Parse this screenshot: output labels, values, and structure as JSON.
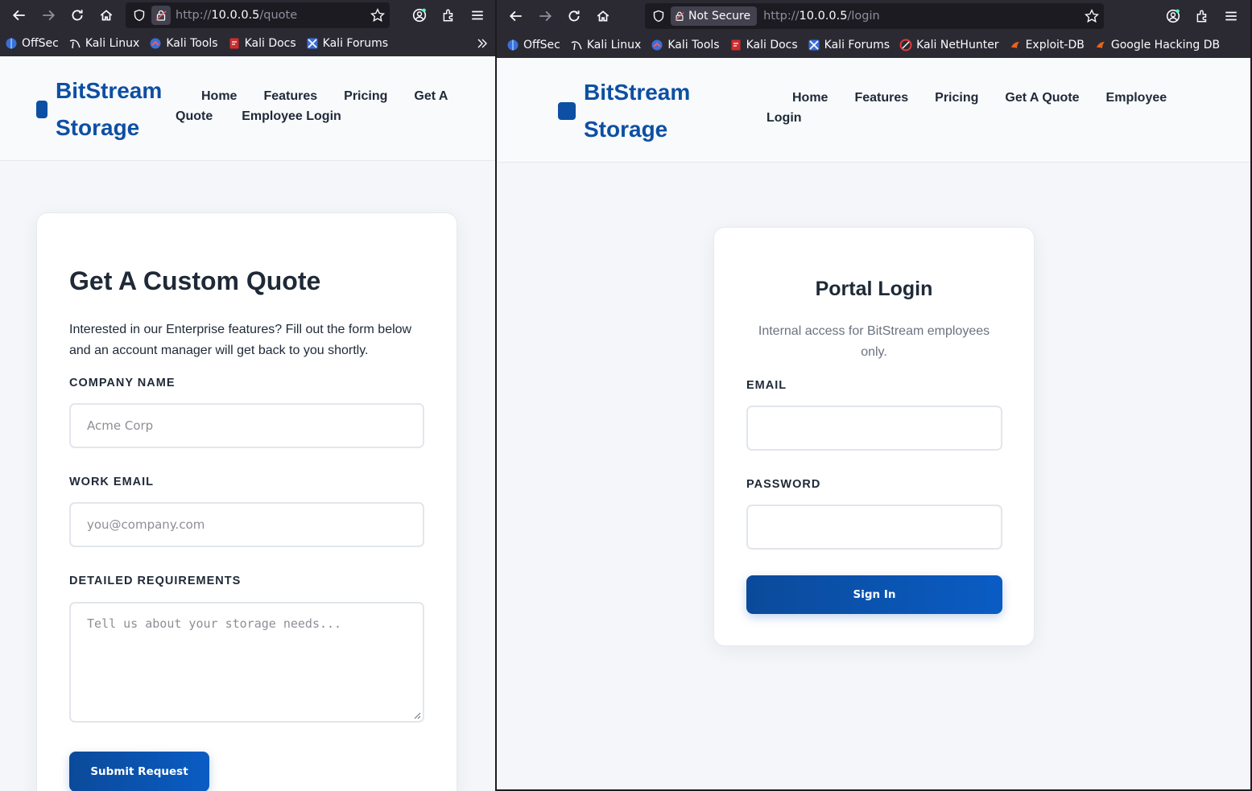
{
  "left_window": {
    "url_scheme": "http://",
    "url_host": "10.0.0.5",
    "url_path": "/quote",
    "bookmarks": [
      {
        "label": "OffSec",
        "icon": "offsec-icon"
      },
      {
        "label": "Kali Linux",
        "icon": "kali-dragon-icon"
      },
      {
        "label": "Kali Tools",
        "icon": "kali-tools-icon"
      },
      {
        "label": "Kali Docs",
        "icon": "kali-docs-icon"
      },
      {
        "label": "Kali Forums",
        "icon": "kali-forums-icon"
      }
    ]
  },
  "right_window": {
    "not_secure_label": "Not Secure",
    "url_scheme": "http://",
    "url_host": "10.0.0.5",
    "url_path": "/login",
    "bookmarks": [
      {
        "label": "OffSec",
        "icon": "offsec-icon"
      },
      {
        "label": "Kali Linux",
        "icon": "kali-dragon-icon"
      },
      {
        "label": "Kali Tools",
        "icon": "kali-tools-icon"
      },
      {
        "label": "Kali Docs",
        "icon": "kali-docs-icon"
      },
      {
        "label": "Kali Forums",
        "icon": "kali-forums-icon"
      },
      {
        "label": "Kali NetHunter",
        "icon": "nethunter-icon"
      },
      {
        "label": "Exploit-DB",
        "icon": "exploit-db-icon"
      },
      {
        "label": "Google Hacking DB",
        "icon": "ghdb-icon"
      }
    ]
  },
  "site": {
    "logo_line1": "BitStream",
    "logo_line2": "Storage",
    "nav": {
      "home": "Home",
      "features": "Features",
      "pricing": "Pricing",
      "quote_left_a": "Get A",
      "quote_left_b": "Quote",
      "quote_right": "Get A Quote",
      "employee_left": "Employee Login",
      "employee_right_a": "Employee",
      "employee_right_b": "Login"
    }
  },
  "quote_page": {
    "title": "Get A Custom Quote",
    "lead": "Interested in our Enterprise features? Fill out the form below and an account manager will get back to you shortly.",
    "company_label": "COMPANY NAME",
    "company_placeholder": "Acme Corp",
    "email_label": "WORK EMAIL",
    "email_placeholder": "you@company.com",
    "requirements_label": "DETAILED REQUIREMENTS",
    "requirements_placeholder": "Tell us about your storage needs...",
    "submit_label": "Submit Request"
  },
  "login_page": {
    "title": "Portal Login",
    "subtitle": "Internal access for BitStream employees only.",
    "email_label": "EMAIL",
    "password_label": "PASSWORD",
    "submit_label": "Sign In"
  },
  "colors": {
    "brand": "#0d4fa3",
    "chrome": "#2b2a33",
    "page_bg": "#f4f6f9"
  }
}
